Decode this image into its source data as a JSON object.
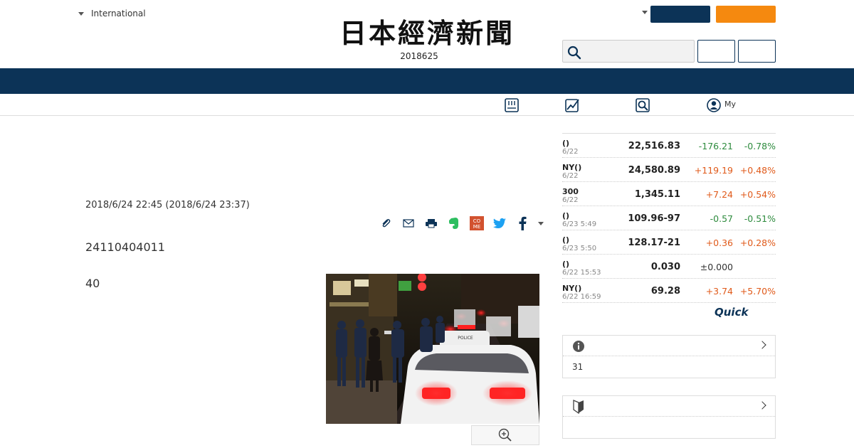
{
  "header": {
    "edition": "International",
    "masthead": "日本經濟新聞",
    "date": "2018625"
  },
  "subnav": {
    "my_label": "My"
  },
  "article": {
    "timestamp": "2018/6/24 22:45 (2018/6/24 23:37)",
    "lead": "24110404011",
    "paragraph2": "40"
  },
  "markets": [
    {
      "name": "()",
      "date": "6/22",
      "value": "22,516.83",
      "change": "-176.21",
      "pct": "-0.78%",
      "dir": "down"
    },
    {
      "name": "NY()",
      "date": "6/22",
      "value": "24,580.89",
      "change": "+119.19",
      "pct": "+0.48%",
      "dir": "up"
    },
    {
      "name": "300",
      "date": "6/22",
      "value": "1,345.11",
      "change": "+7.24",
      "pct": "+0.54%",
      "dir": "up"
    },
    {
      "name": "()",
      "date": "6/23 5:49",
      "value": "109.96-97",
      "change": "-0.57",
      "pct": "-0.51%",
      "dir": "down"
    },
    {
      "name": "()",
      "date": "6/23 5:50",
      "value": "128.17-21",
      "change": "+0.36",
      "pct": "+0.28%",
      "dir": "up"
    },
    {
      "name": "()",
      "date": "6/22 15:53",
      "value": "0.030",
      "change": "±0.000",
      "pct": "",
      "dir": "flat"
    },
    {
      "name": "NY()",
      "date": "6/22 16:59",
      "value": "69.28",
      "change": "+3.74",
      "pct": "+5.70%",
      "dir": "up"
    }
  ],
  "quick_logo": "Quick",
  "panels": {
    "info_body": "31",
    "beginner_body": ""
  },
  "colors": {
    "navy": "#0c3357",
    "orange": "#f5890f",
    "up": "#e05a1a",
    "down": "#2e8b3e"
  },
  "icons": [
    "caret-down-icon",
    "search-icon",
    "newspaper-icon",
    "chart-icon",
    "magnifier-icon",
    "user-icon",
    "clip-icon",
    "mail-icon",
    "print-icon",
    "evernote-icon",
    "comemo-icon",
    "twitter-icon",
    "facebook-icon",
    "zoom-in-icon",
    "info-icon",
    "beginner-icon",
    "chevron-right-icon"
  ]
}
